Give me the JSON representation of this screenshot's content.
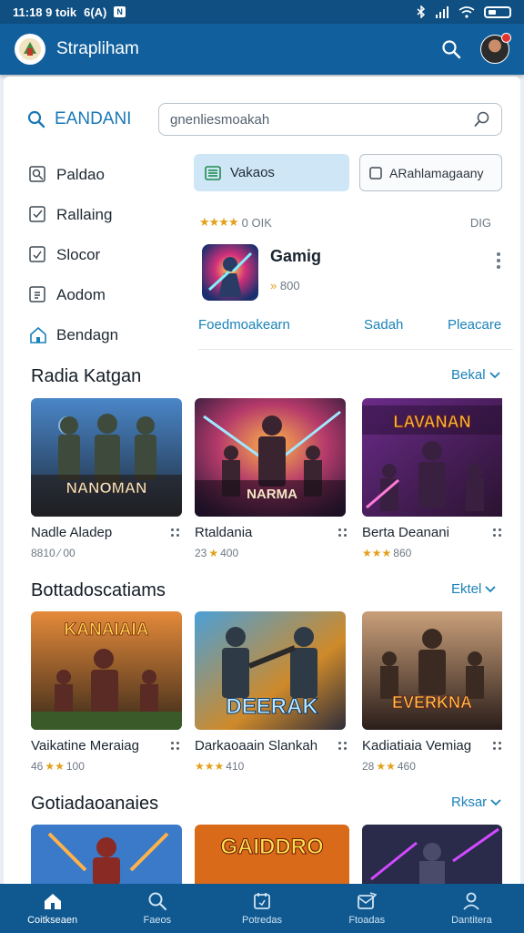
{
  "status_bar": {
    "time_text": "11:18 9 toik",
    "badge1": "6(A)",
    "badge2": "N"
  },
  "app_bar": {
    "title": "Strapliham"
  },
  "brand": {
    "label": "EANDANI"
  },
  "search": {
    "value": "gnenliesmoakah"
  },
  "sidenav": {
    "items": [
      {
        "label": "Paldao"
      },
      {
        "label": "Rallaing"
      },
      {
        "label": "Slocor"
      },
      {
        "label": "Aodom"
      },
      {
        "label": "Bendagn"
      }
    ]
  },
  "tabs": {
    "active": "Vakaos",
    "other": "ARahlamagaany"
  },
  "featured": {
    "rating_text": "0 OIK",
    "rating_right": "DIG",
    "title": "Gamig",
    "meta": "800",
    "links": [
      "Foedmoakearn",
      "Sadah",
      "Pleacare"
    ]
  },
  "sections": [
    {
      "title": "Radia Katgan",
      "link": "Bekal",
      "items": [
        {
          "title": "Nadle Aladep",
          "meta": "8810 ⁄ 00",
          "banner": "NANOMAN"
        },
        {
          "title": "Rtaldania",
          "meta": "400",
          "meta_prefix": "23",
          "banner": "NARMA"
        },
        {
          "title": "Berta Deanani",
          "meta": "860",
          "banner": "LAVANAN"
        }
      ]
    },
    {
      "title": "Bottadoscatiams",
      "link": "Ektel",
      "items": [
        {
          "title": "Vaikatine Meraiag",
          "meta": "100",
          "meta_prefix": "46",
          "banner": "KANAIAIA"
        },
        {
          "title": "Darkaoaain Slankah",
          "meta": "410",
          "banner": "DEERAK"
        },
        {
          "title": "Kadiatiaia Vemiag",
          "meta": "460",
          "meta_prefix": "28",
          "banner": "EVERKNA"
        }
      ]
    },
    {
      "title": "Gotiadaoanaies",
      "link": "Rksar",
      "items": [
        {
          "banner": ""
        },
        {
          "banner": "GAIDDRO"
        },
        {
          "banner": ""
        }
      ]
    }
  ],
  "bottom_nav": [
    {
      "label": "Coitkseaen",
      "icon": "home-icon"
    },
    {
      "label": "Faeos",
      "icon": "search-icon"
    },
    {
      "label": "Potredas",
      "icon": "calendar-icon"
    },
    {
      "label": "Ftoadas",
      "icon": "inbox-icon"
    },
    {
      "label": "Dantitera",
      "icon": "person-icon"
    }
  ],
  "colors": {
    "primary": "#11609d",
    "accent": "#1a82b9",
    "star": "#e3a11b",
    "tab_active_bg": "#cfe6f7"
  }
}
